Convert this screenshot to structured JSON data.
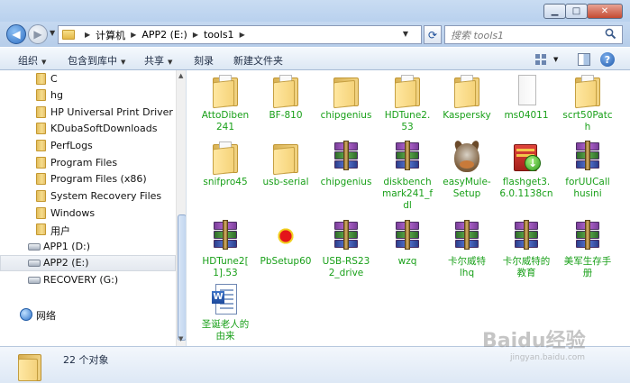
{
  "window": {
    "caption_buttons": [
      "minimize",
      "maximize",
      "close"
    ]
  },
  "address": {
    "crumbs": [
      "计算机",
      "APP2 (E:)",
      "tools1"
    ],
    "search_placeholder": "搜索 tools1"
  },
  "toolbar": {
    "organize": "组织",
    "include_in_library": "包含到库中",
    "share": "共享",
    "burn": "刻录",
    "new_folder": "新建文件夹"
  },
  "nav": {
    "items": [
      {
        "label": "C",
        "icon": "folder-icon"
      },
      {
        "label": "hg",
        "icon": "folder-icon"
      },
      {
        "label": "HP Universal Print Driver",
        "icon": "folder-icon"
      },
      {
        "label": "KDubaSoftDownloads",
        "icon": "folder-icon"
      },
      {
        "label": "PerfLogs",
        "icon": "folder-icon"
      },
      {
        "label": "Program Files",
        "icon": "folder-icon"
      },
      {
        "label": "Program Files (x86)",
        "icon": "folder-icon"
      },
      {
        "label": "System Recovery Files",
        "icon": "folder-icon"
      },
      {
        "label": "Windows",
        "icon": "folder-icon"
      },
      {
        "label": "用户",
        "icon": "folder-icon"
      },
      {
        "label": "APP1 (D:)",
        "icon": "drive-icon"
      },
      {
        "label": "APP2 (E:)",
        "icon": "drive-icon",
        "selected": true
      },
      {
        "label": "RECOVERY (G:)",
        "icon": "drive-icon"
      },
      {
        "label": "网络",
        "icon": "network-icon"
      }
    ]
  },
  "content": {
    "items": [
      {
        "label": "AttoDiben241",
        "lines": [
          "AttoDiben",
          "241"
        ],
        "icon": "folder-icon"
      },
      {
        "label": "BF-810",
        "lines": [
          "BF-810"
        ],
        "icon": "folder-icon"
      },
      {
        "label": "chipgenius",
        "lines": [
          "chipgenius"
        ],
        "icon": "folder-icon"
      },
      {
        "label": "HDTune2.53",
        "lines": [
          "HDTune2.",
          "53"
        ],
        "icon": "folder-icon"
      },
      {
        "label": "Kaspersky",
        "lines": [
          "Kaspersky"
        ],
        "icon": "folder-icon"
      },
      {
        "label": "ms04011",
        "lines": [
          "ms04011"
        ],
        "icon": "page-icon"
      },
      {
        "label": "scrt50Patch",
        "lines": [
          "scrt50Patc",
          "h"
        ],
        "icon": "folder-icon"
      },
      {
        "label": "snifpro45",
        "lines": [
          "snifpro45"
        ],
        "icon": "folder-icon"
      },
      {
        "label": "usb-serial",
        "lines": [
          "usb-serial"
        ],
        "icon": "folder-icon"
      },
      {
        "label": "chipgenius",
        "lines": [
          "chipgenius"
        ],
        "icon": "winrar-icon"
      },
      {
        "label": "diskbenchmark241_fdl",
        "lines": [
          "diskbench",
          "mark241_f",
          "dl"
        ],
        "icon": "winrar-icon"
      },
      {
        "label": "easyMule-Setup",
        "lines": [
          "easyMule-",
          "Setup"
        ],
        "icon": "mule-icon"
      },
      {
        "label": "flashget3.6.0.1138cn",
        "lines": [
          "flashget3.",
          "6.0.1138cn"
        ],
        "icon": "flashget-icon"
      },
      {
        "label": "forUUCallhusini",
        "lines": [
          "forUUCall",
          "husini"
        ],
        "icon": "winrar-icon"
      },
      {
        "label": "HDTune2[1].53",
        "lines": [
          "HDTune2[",
          "1].53"
        ],
        "icon": "winrar-icon"
      },
      {
        "label": "PbSetup60",
        "lines": [
          "PbSetup60"
        ],
        "icon": "pbsetup-icon"
      },
      {
        "label": "USB-RS232_drive",
        "lines": [
          "USB-RS23",
          "2_drive"
        ],
        "icon": "winrar-icon"
      },
      {
        "label": "wzq",
        "lines": [
          "wzq"
        ],
        "icon": "winrar-icon"
      },
      {
        "label": "卡尔威特lhq",
        "lines": [
          "卡尔威特",
          "lhq"
        ],
        "icon": "winrar-icon"
      },
      {
        "label": "卡尔威特的教育",
        "lines": [
          "卡尔威特的",
          "教育"
        ],
        "icon": "winrar-icon"
      },
      {
        "label": "美军生存手册",
        "lines": [
          "美军生存手",
          "册"
        ],
        "icon": "winrar-icon"
      },
      {
        "label": "圣诞老人的由来",
        "lines": [
          "圣诞老人的",
          "由来"
        ],
        "icon": "word-doc-icon"
      }
    ]
  },
  "details": {
    "count": "22 个对象"
  },
  "watermark": {
    "brand": "Baidu经验",
    "url": "jingyan.baidu.com"
  },
  "colors": {
    "item_label": "#19a019",
    "titlebar": "#c9dcf2",
    "toolbar": "#dce7f4"
  }
}
